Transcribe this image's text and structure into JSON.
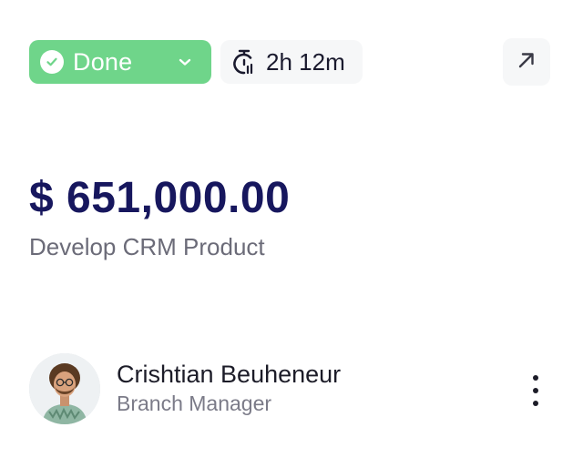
{
  "status": {
    "label": "Done",
    "color": "#6fd58a",
    "icon": "check-circle-icon",
    "dropdown_icon": "chevron-down-icon"
  },
  "timer": {
    "value": "2h 12m",
    "icon": "stopwatch-icon"
  },
  "open_action": {
    "icon": "arrow-up-right-icon"
  },
  "deal": {
    "amount": "$ 651,000.00",
    "amount_color": "#17175e",
    "project": "Develop CRM Product"
  },
  "owner": {
    "name": "Crishtian Beuheneur",
    "role": "Branch Manager",
    "avatar_icon": "avatar-photo"
  },
  "more_action": {
    "icon": "more-vertical-icon"
  }
}
